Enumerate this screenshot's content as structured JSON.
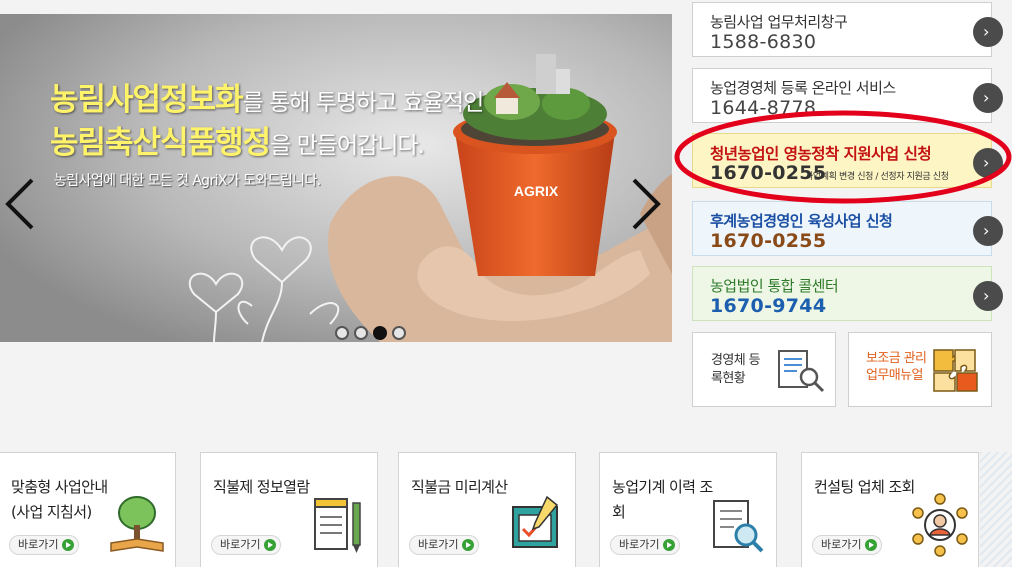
{
  "slider": {
    "headline_1_accent": "농림사업정보화",
    "headline_1_rest": "를 통해 투명하고 효율적인",
    "headline_2_accent": "농림축산식품행정",
    "headline_2_rest": "을 만들어갑니다.",
    "subtext": "농림사업에 대한 모든 것 AgriX가 도와드립니다.",
    "pot_logo": "AGRIX",
    "dots": [
      {
        "active": false
      },
      {
        "active": false
      },
      {
        "active": true
      },
      {
        "active": false
      }
    ],
    "prev_icon": "chevron-left-icon",
    "next_icon": "chevron-right-icon"
  },
  "services": [
    {
      "title": "농림사업 업무처리창구",
      "phone": "1588-6830",
      "icon": "chevron-right-icon"
    },
    {
      "title": "농업경영체 등록 온라인 서비스",
      "phone": "1644-8778",
      "icon": "chevron-right-icon"
    },
    {
      "title": "청년농업인 영농정착 지원사업 신청",
      "phone": "1670-0255",
      "note": "사업계획 변경 신청 / 선정자 지원금 신청",
      "icon": "chevron-right-icon",
      "highlight_color": "#e3001b"
    },
    {
      "title": "후계농업경영인 육성사업 신청",
      "phone": "1670-0255",
      "icon": "chevron-right-icon"
    },
    {
      "title": "농업법인 통합 콜센터",
      "phone": "1670-9744",
      "icon": "chevron-right-icon"
    }
  ],
  "tiles": [
    {
      "label": "경영체 등록현황",
      "icon": "document-search-icon"
    },
    {
      "label": "보조금 관리 업무매뉴얼",
      "icon": "puzzle-icon"
    }
  ],
  "cards": [
    {
      "title": "맞춤형 사업안내 (사업 지침서)",
      "button": "바로가기",
      "icon": "tree-book-icon"
    },
    {
      "title": "직불제 정보열람",
      "button": "바로가기",
      "icon": "notepad-pencil-icon"
    },
    {
      "title": "직불금 미리계산",
      "button": "바로가기",
      "icon": "calculator-pen-icon"
    },
    {
      "title": "농업기계 이력 조회",
      "button": "바로가기",
      "icon": "document-magnifier-icon"
    },
    {
      "title": "컨설팅 업체 조회",
      "button": "바로가기",
      "icon": "consultant-network-icon"
    }
  ],
  "colors": {
    "accent_yellow": "#fff36a",
    "highlight_red": "#e3001b",
    "go_button": "#4b4b4b",
    "link_green": "#36a135"
  }
}
